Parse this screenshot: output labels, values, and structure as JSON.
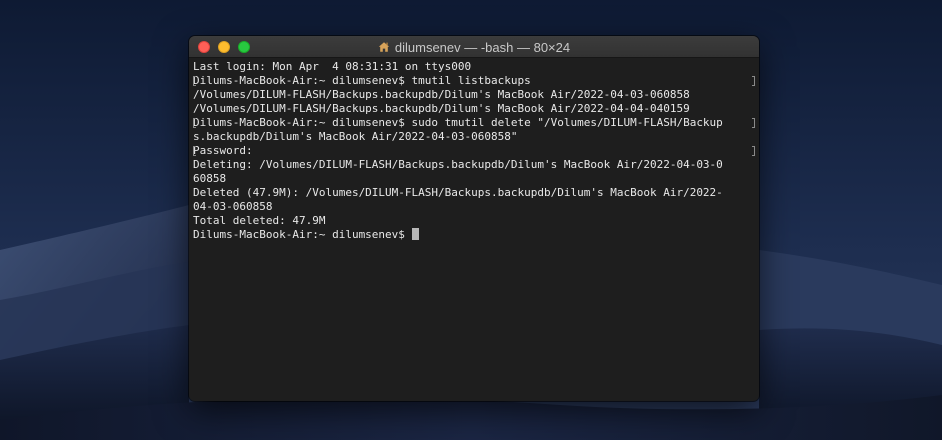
{
  "window": {
    "title": "dilumsenev — -bash — 80×24",
    "title_icon": "house-icon"
  },
  "terminal": {
    "lines": [
      "Last login: Mon Apr  4 08:31:31 on ttys000",
      "Dilums-MacBook-Air:~ dilumsenev$ tmutil listbackups",
      "/Volumes/DILUM-FLASH/Backups.backupdb/Dilum's MacBook Air/2022-04-03-060858",
      "/Volumes/DILUM-FLASH/Backups.backupdb/Dilum's MacBook Air/2022-04-04-040159",
      "Dilums-MacBook-Air:~ dilumsenev$ sudo tmutil delete \"/Volumes/DILUM-FLASH/Backup",
      "s.backupdb/Dilum's MacBook Air/2022-04-03-060858\"",
      "Password:",
      "Deleting: /Volumes/DILUM-FLASH/Backups.backupdb/Dilum's MacBook Air/2022-04-03-0",
      "60858",
      "Deleted (47.9M): /Volumes/DILUM-FLASH/Backups.backupdb/Dilum's MacBook Air/2022-",
      "04-03-060858",
      "Total deleted: 47.9M"
    ],
    "prompt": "Dilums-MacBook-Air:~ dilumsenev$ "
  },
  "colors": {
    "terminal_background": "#1e1e1e",
    "terminal_text": "#e8e8e8",
    "close_button": "#fe5f57",
    "minimize_button": "#febc2e",
    "zoom_button": "#28c840",
    "desktop": "#131c33"
  }
}
